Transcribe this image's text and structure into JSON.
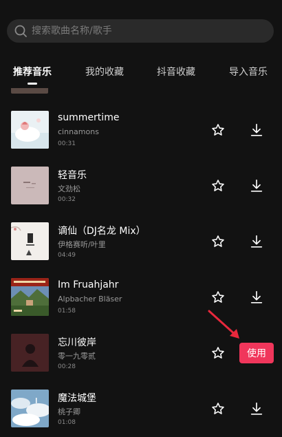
{
  "search": {
    "placeholder": "搜索歌曲名称/歌手"
  },
  "tabs": [
    {
      "label": "推荐音乐",
      "active": true
    },
    {
      "label": "我的收藏",
      "active": false
    },
    {
      "label": "抖音收藏",
      "active": false
    },
    {
      "label": "导入音乐",
      "active": false
    }
  ],
  "songs": [
    {
      "title": "summertime",
      "artist": "cinnamons",
      "duration": "00:31",
      "action": "download"
    },
    {
      "title": "轻音乐",
      "artist": "文劲松",
      "duration": "00:32",
      "action": "download"
    },
    {
      "title": "谪仙（DJ名龙 Mix）",
      "artist": "伊格赛听/叶里",
      "duration": "04:49",
      "action": "download"
    },
    {
      "title": "Im Fruahjahr",
      "artist": "Alpbacher Bläser",
      "duration": "01:58",
      "action": "download"
    },
    {
      "title": "忘川彼岸",
      "artist": "零一九零贰",
      "duration": "00:28",
      "action": "use"
    },
    {
      "title": "魔法城堡",
      "artist": "桃子卿",
      "duration": "01:08",
      "action": "download"
    }
  ],
  "use_button": {
    "label": "使用"
  },
  "colors": {
    "background": "#121212",
    "accent": "#f0365b",
    "arrow": "#e8283c"
  },
  "icons": {
    "search": "search-icon",
    "favorite": "star-outline-icon",
    "download": "download-icon"
  }
}
